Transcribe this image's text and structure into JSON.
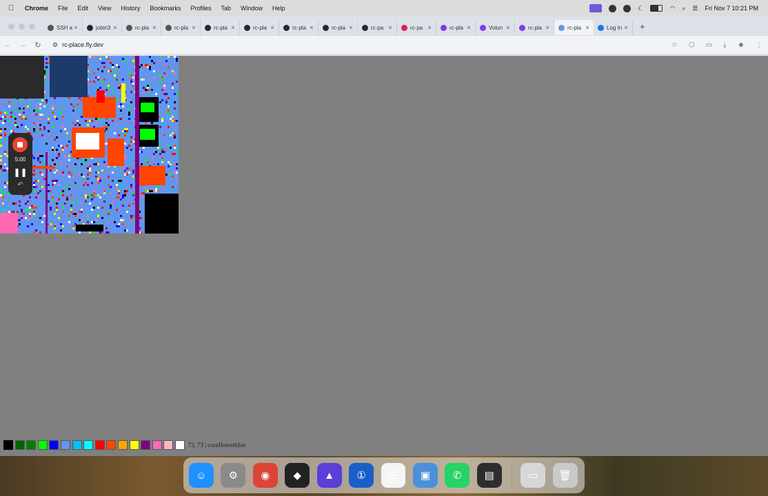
{
  "menubar": {
    "app_name": "Chrome",
    "items": [
      "File",
      "Edit",
      "View",
      "History",
      "Bookmarks",
      "Profiles",
      "Tab",
      "Window",
      "Help"
    ],
    "datetime": "Fri Nov 7  10:21 PM"
  },
  "tabs": [
    {
      "title": "SSH a",
      "icon": "globe-icon",
      "color": "#555555"
    },
    {
      "title": "jobin3",
      "icon": "github-icon",
      "color": "#24292e"
    },
    {
      "title": "rc-pla",
      "icon": "globe-icon",
      "color": "#555555"
    },
    {
      "title": "rc-pla",
      "icon": "globe-icon",
      "color": "#555555"
    },
    {
      "title": "rc-pla",
      "icon": "github-icon",
      "color": "#24292e"
    },
    {
      "title": "rc-pla",
      "icon": "github-icon",
      "color": "#24292e"
    },
    {
      "title": "rc-pla",
      "icon": "github-icon",
      "color": "#24292e"
    },
    {
      "title": "rc-pla",
      "icon": "github-icon",
      "color": "#24292e"
    },
    {
      "title": "rc-pa",
      "icon": "github-icon",
      "color": "#24292e"
    },
    {
      "title": "rc-pa",
      "icon": "slack-icon",
      "color": "#e01e5a"
    },
    {
      "title": "rc-pla",
      "icon": "fly-icon",
      "color": "#7b3fe4"
    },
    {
      "title": "Volun",
      "icon": "fly-icon",
      "color": "#7b3fe4"
    },
    {
      "title": "rc-pla",
      "icon": "fly-icon",
      "color": "#7b3fe4"
    },
    {
      "title": "rc-pla",
      "icon": "rcplace-icon",
      "color": "#6495ed",
      "active": true
    },
    {
      "title": "Log In",
      "icon": "chrome-icon",
      "color": "#1a73e8"
    }
  ],
  "url": "rc-place.fly.dev",
  "recorder": {
    "time": "5:00"
  },
  "palette": {
    "colors": [
      "#000000",
      "#006400",
      "#008000",
      "#00ff00",
      "#0000ff",
      "#6495ed",
      "#00bfff",
      "#00ffff",
      "#ff0000",
      "#ff4500",
      "#ffa500",
      "#ffff00",
      "#800080",
      "#ff69b4",
      "#ffb6c1",
      "#ffffff"
    ],
    "selected_index": 0,
    "coords_text": "73, 73 | cornflowerblue"
  },
  "dock": {
    "apps": [
      {
        "name": "finder-icon",
        "color": "#1e90ff",
        "glyph": "☺"
      },
      {
        "name": "system-settings-icon",
        "color": "#8a8a8a",
        "glyph": "⚙"
      },
      {
        "name": "chrome-icon",
        "color": "#db4437",
        "glyph": "◉"
      },
      {
        "name": "unity-icon",
        "color": "#222222",
        "glyph": "◆"
      },
      {
        "name": "proton-icon",
        "color": "#5b3fd6",
        "glyph": "▲"
      },
      {
        "name": "1password-icon",
        "color": "#1a5fc7",
        "glyph": "①"
      },
      {
        "name": "reminders-icon",
        "color": "#f5f5f5",
        "glyph": "☰"
      },
      {
        "name": "preview-icon",
        "color": "#4a90d9",
        "glyph": "▣"
      },
      {
        "name": "whatsapp-icon",
        "color": "#25d366",
        "glyph": "✆"
      },
      {
        "name": "terminal-icon",
        "color": "#2d2d2d",
        "glyph": "▤"
      }
    ],
    "extras": [
      {
        "name": "documents-icon",
        "color": "#d7d7d7",
        "glyph": "▭"
      },
      {
        "name": "trash-icon",
        "color": "#c9c9c9",
        "glyph": "🗑"
      }
    ]
  }
}
